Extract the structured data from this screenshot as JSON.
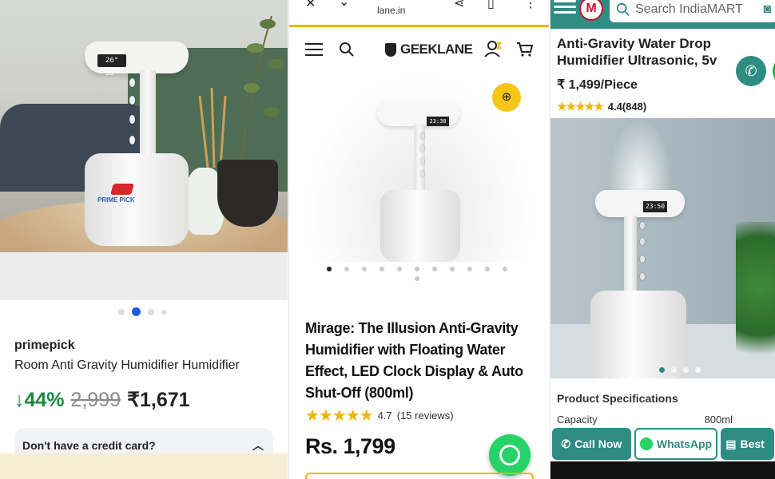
{
  "panel1": {
    "clock": "26° 55°",
    "brand": "PRIME PICK",
    "seller": "primepick",
    "title": "Room Anti Gravity Humidifier Humidifier",
    "discount": "↓44%",
    "mrp": "2,999",
    "price": "₹1,671",
    "credit_card": "Don't have a credit card?",
    "icons": [
      "chevron-up-icon"
    ]
  },
  "panel2": {
    "url": "lane.in",
    "logo": "GEEKLANE",
    "clock": "23:38",
    "title": "Mirage: The Illusion Anti-Gravity Humidifier with Floating Water Effect, LED Clock Display & Auto Shut-Off (800ml)",
    "rating": "4.7",
    "reviews": "(15 reviews)",
    "stars": "★★★★★",
    "price": "Rs. 1,799",
    "colors": {
      "accent": "#f0b400",
      "whatsapp": "#25d366"
    },
    "icons": [
      "close-icon",
      "chevron-down-icon",
      "share-icon",
      "bookmark-icon",
      "more-icon",
      "menu-icon",
      "search-icon",
      "account-icon",
      "cart-icon",
      "zoom-icon",
      "whatsapp-icon"
    ]
  },
  "panel3": {
    "logo": "M",
    "search_placeholder": "Search IndiaMART",
    "title": "Anti-Gravity Water Drop Humidifier Ultrasonic, 5v",
    "price": "₹ 1,499/Piece",
    "stars": "★★★★★",
    "rating": "4.4(848)",
    "clock": "23:50",
    "specs_heading": "Product Specifications",
    "spec_label": "Capacity",
    "spec_value": "800ml",
    "call_now": "Call Now",
    "whatsapp": "WhatsApp",
    "best": "Best",
    "colors": {
      "brand": "#2e8c83"
    },
    "icons": [
      "menu-icon",
      "search-icon",
      "camera-icon",
      "phone-icon",
      "whatsapp-icon",
      "chat-icon"
    ]
  }
}
